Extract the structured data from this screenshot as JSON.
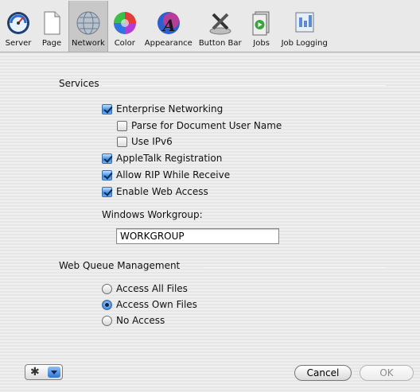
{
  "toolbar": {
    "items": [
      {
        "label": "Server",
        "icon": "server-icon",
        "selected": false
      },
      {
        "label": "Page",
        "icon": "page-icon",
        "selected": false
      },
      {
        "label": "Network",
        "icon": "network-icon",
        "selected": true
      },
      {
        "label": "Color",
        "icon": "color-icon",
        "selected": false
      },
      {
        "label": "Appearance",
        "icon": "appearance-icon",
        "selected": false
      },
      {
        "label": "Button Bar",
        "icon": "button-bar-icon",
        "selected": false
      },
      {
        "label": "Jobs",
        "icon": "jobs-icon",
        "selected": false
      },
      {
        "label": "Job Logging",
        "icon": "job-logging-icon",
        "selected": false
      }
    ]
  },
  "services": {
    "title": "Services",
    "enterprise_networking": {
      "label": "Enterprise Networking",
      "checked": true
    },
    "parse_user_name": {
      "label": "Parse for Document User Name",
      "checked": false
    },
    "use_ipv6": {
      "label": "Use IPv6",
      "checked": false
    },
    "appletalk": {
      "label": "AppleTalk Registration",
      "checked": true
    },
    "allow_rip": {
      "label": "Allow RIP While Receive",
      "checked": true
    },
    "web_access": {
      "label": "Enable Web Access",
      "checked": true
    },
    "workgroup_label": "Windows Workgroup:",
    "workgroup_value": "WORKGROUP"
  },
  "web_queue": {
    "title": "Web Queue Management",
    "options": [
      {
        "label": "Access All Files",
        "selected": false
      },
      {
        "label": "Access Own Files",
        "selected": true
      },
      {
        "label": "No Access",
        "selected": false
      }
    ]
  },
  "footer": {
    "cancel_label": "Cancel",
    "ok_label": "OK"
  },
  "colors": {
    "accent": "#3a86e0"
  }
}
